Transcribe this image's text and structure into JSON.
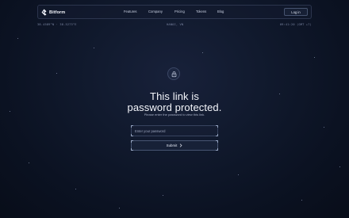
{
  "nav": {
    "brand": "Bitform",
    "links": [
      "Features",
      "Company",
      "Pricing",
      "Tokens",
      "Blog"
    ],
    "login_label": "Log in"
  },
  "info_strip": {
    "coordinates": "38.4589°N · 38.5273°E",
    "location": "HANOI, VN",
    "time": "09:41:20 (GMT +7)"
  },
  "main": {
    "title_line1": "This link is",
    "title_line2": "password protected.",
    "subtitle": "Please enter the password to view this link."
  },
  "form": {
    "password_placeholder": "Enter your password",
    "submit_label": "Submit"
  },
  "icons": {
    "brand": "bitform-logo-icon",
    "lock": "lock-icon",
    "submit": "chevron-right-icon"
  }
}
